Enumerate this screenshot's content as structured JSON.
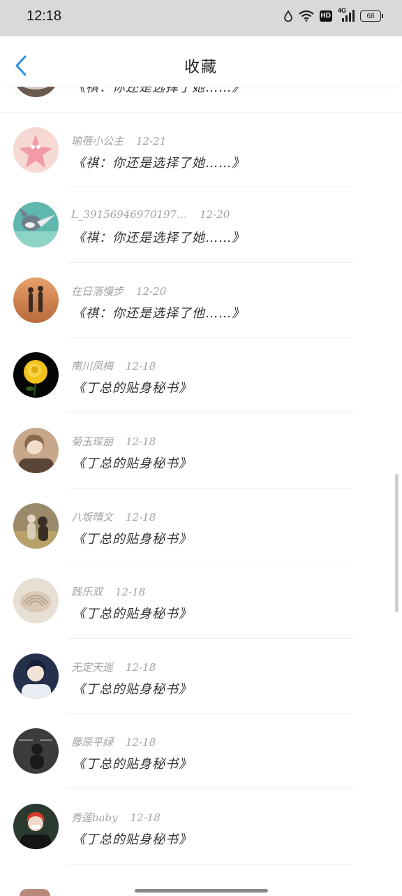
{
  "status_bar": {
    "time": "12:18",
    "battery": "68",
    "hd_label": "HD",
    "network": "4G"
  },
  "header": {
    "title": "收藏",
    "back_icon": "chevron-left-icon",
    "accent_color": "#2e8ee0"
  },
  "items": [
    {
      "author": "",
      "date": "",
      "message": "《祺：你还是选择了她……》",
      "avatar": "pearl-shell-icon"
    },
    {
      "author": "瑜蓓小公主",
      "date": "12-21",
      "message": "《祺：你还是选择了她……》",
      "avatar": "patrick-star-icon"
    },
    {
      "author": "L_39156946970197…",
      "date": "12-20",
      "message": "《祺：你还是选择了她……》",
      "avatar": "tom-cat-icon"
    },
    {
      "author": "在日落慢步",
      "date": "12-20",
      "message": "《祺：你还是选择了他……》",
      "avatar": "sunset-girls-icon"
    },
    {
      "author": "南川凤梅",
      "date": "12-18",
      "message": "《丁总的贴身秘书》",
      "avatar": "yellow-rose-icon"
    },
    {
      "author": "菊玉琛丽",
      "date": "12-18",
      "message": "《丁总的贴身秘书》",
      "avatar": "girl-portrait-icon"
    },
    {
      "author": "八坂晴文",
      "date": "12-18",
      "message": "《丁总的贴身秘书》",
      "avatar": "field-girl-icon"
    },
    {
      "author": "践乐双",
      "date": "12-18",
      "message": "《丁总的贴身秘书》",
      "avatar": "seashell-icon"
    },
    {
      "author": "无定天遥",
      "date": "12-18",
      "message": "《丁总的贴身秘书》",
      "avatar": "anime-boy-icon"
    },
    {
      "author": "藤原平绿",
      "date": "12-18",
      "message": "《丁总的贴身秘书》",
      "avatar": "dark-photo-icon"
    },
    {
      "author": "秀莲baby",
      "date": "12-18",
      "message": "《丁总的贴身秘书》",
      "avatar": "red-hair-person-icon"
    }
  ]
}
